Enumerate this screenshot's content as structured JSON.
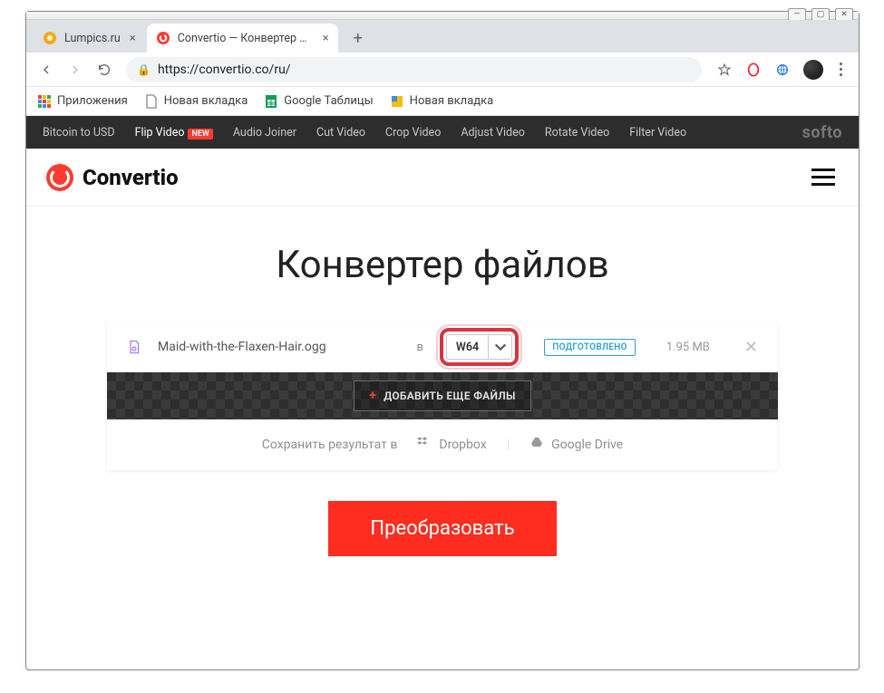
{
  "os": {
    "min": "—",
    "max": "▢",
    "close": "✕"
  },
  "tabs": [
    {
      "title": "Lumpics.ru",
      "active": false
    },
    {
      "title": "Convertio — Конвертер файлов",
      "active": true
    }
  ],
  "urlbar": {
    "url": "https://convertio.co/ru/"
  },
  "bookmarks": {
    "apps": "Приложения",
    "items": [
      "Новая вкладка",
      "Google Таблицы",
      "Новая вкладка"
    ]
  },
  "softo": {
    "links": [
      "Bitcoin to USD",
      "Flip Video",
      "Audio Joiner",
      "Cut Video",
      "Crop Video",
      "Adjust Video",
      "Rotate Video",
      "Filter Video"
    ],
    "new_badge": "NEW",
    "logo": "softo"
  },
  "header": {
    "brand": "Convertio"
  },
  "page": {
    "title": "Конвертер файлов",
    "file": {
      "name": "Maid-with-the-Flaxen-Hair.ogg",
      "to_label": "в",
      "format": "W64",
      "status": "ПОДГОТОВЛЕНО",
      "size": "1.95 MB"
    },
    "add_more": "ДОБАВИТЬ ЕЩЕ ФАЙЛЫ",
    "save": {
      "label": "Сохранить результат в",
      "dropbox": "Dropbox",
      "gdrive": "Google Drive"
    },
    "convert": "Преобразовать"
  }
}
